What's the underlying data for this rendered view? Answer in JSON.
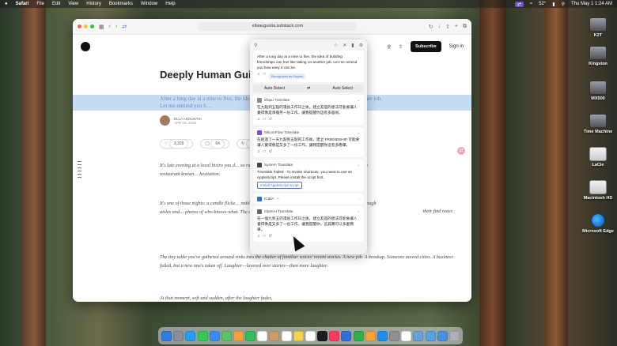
{
  "menubar": {
    "apple": "",
    "app": "Safari",
    "items": [
      "File",
      "Edit",
      "View",
      "History",
      "Bookmarks",
      "Window",
      "Help"
    ],
    "status": [
      "52°",
      "Thu May 1  1:24 AM"
    ]
  },
  "desktop": {
    "icons": [
      {
        "label": "K2T",
        "name": "drive-k2t-icon"
      },
      {
        "label": "Kingston",
        "name": "drive-kingston-icon"
      },
      {
        "label": "MX500",
        "name": "drive-mx500-icon"
      },
      {
        "label": "Time Machine",
        "name": "drive-time-machine-icon"
      },
      {
        "label": "LaCie",
        "name": "drive-lacie-icon"
      },
      {
        "label": "Macintosh HD",
        "name": "drive-macintosh-hd-icon"
      },
      {
        "label": "Microsoft Edge",
        "name": "microsoft-edge-icon"
      }
    ]
  },
  "browser": {
    "url": "ellaaugustia.substack.com",
    "subscribe": "Subscribe",
    "signin": "Sign in"
  },
  "article": {
    "title": "Deeply Human Gui… Make You Feel Alive",
    "subtitle": "After a long day at a nine to five, the idea of building friendships can feel like taking on another job. Let me remind you h…",
    "author": "ELLA AUGUSTIA",
    "date": "APR 06, 2025",
    "likes": "3,329",
    "comments": "64",
    "restacks": "463",
    "p1": "It's late evening at a local bistro you d… so rarely see these days. No reservation, j… cramped corner of a restaurant known… hesitation.",
    "p2": "It's one of those nights: a candle flicke… reddish hue. Somewhere in the backgr… rhythm as they pass through aisles and… photos of who-knows-what. The details… that were never quite reach that far.",
    "p2_right": "their find notes",
    "p3": "The tiny table you've gathered around sinks into the chatter of familiar voices' recent stories. A new job. A breakup. Someone moved cities. A business failed, but a new one's taken off. Laughter—layered over stories—then more laughter.",
    "p4": "At that moment, soft and sudden, after the laughter fades,"
  },
  "popup": {
    "source_text": "After a long day at a nine to five, the idea of building friendships can feel like taking on another job. Let me remind you how easy it can be.",
    "detected": "Recognized as English",
    "from_lang": "Auto Detect",
    "to_lang": "Auto Select",
    "services": [
      {
        "name": "Zhipu Translate",
        "text": "在九點到五點的漫長工作日之後，建立友誼的想法可能會讓人覺得像是承擔另一份工作。讓我提醒你這有多容易。",
        "color": "#8a8a8a"
      },
      {
        "name": "SiliconFlow Translate",
        "text": "在經過了一天九點到五點的工作後，建立 FRIENDSHIP 可能會讓人覺得像是又多了一份工作。讓我提醒你這有多簡單。",
        "color": "#7b52d6"
      },
      {
        "name": "System Translate",
        "text": "Translate Failed - To invoke shortcuts, you need to use an AppleScript. Please install the script first.",
        "button": "Install AppleScript Script",
        "color": "#444444"
      },
      {
        "name": "ICIBA",
        "text": "",
        "color": "#2a6fd6"
      },
      {
        "name": "OpenAI Translate",
        "text": "在一個九到五的漫長工作日之後，建立友誼的想法可能會讓人覺得像是又多了一份工作。讓我提醒你，這其實可以多麼簡單。",
        "color": "#666666"
      }
    ]
  },
  "dock": {
    "apps": [
      "finder",
      "launchpad",
      "safari",
      "messages",
      "mail",
      "maps",
      "photos",
      "facetime",
      "calendar",
      "contacts",
      "reminders",
      "notes",
      "freeform",
      "tv",
      "music",
      "keynote",
      "numbers",
      "pages",
      "app-store",
      "settings",
      "textedit",
      "preview",
      "documents",
      "downloads",
      "trash"
    ],
    "colors": [
      "#2f7be0",
      "#8c8c9a",
      "#2a9cf0",
      "#34c759",
      "#3b8bf5",
      "#5ec26a",
      "#f2a33a",
      "#2fbf5a",
      "#ffffff",
      "#c89f6a",
      "#ffffff",
      "#f7d34b",
      "#ffffff",
      "#1c1c1e",
      "#fb3c5a",
      "#2f6fe0",
      "#2fb14a",
      "#f2a33a",
      "#1f8cf0",
      "#8e8e93",
      "#ffffff",
      "#6aa0d8",
      "#5aa0e0",
      "#4a90e2",
      "#b0b0b8"
    ]
  }
}
